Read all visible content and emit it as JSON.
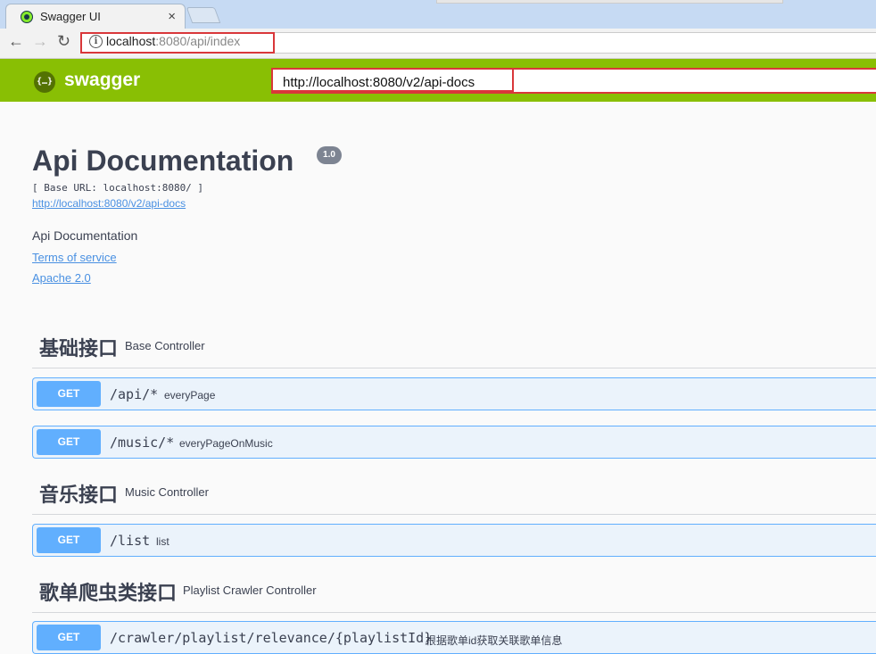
{
  "browser": {
    "tab_title": "Swagger UI",
    "tab_close": "×",
    "url_host": "localhost",
    "url_rest": ":8080/api/index",
    "back": "←",
    "forward": "→",
    "reload": "↻",
    "info": "i"
  },
  "swagger": {
    "logo_glyph": "{…}",
    "logo_text": "swagger",
    "spec_url": "http://localhost:8080/v2/api-docs",
    "highlight_color": "#d9373a",
    "brand_color": "#89bf04"
  },
  "info": {
    "title": "Api Documentation",
    "version": "1.0",
    "base_url": "[ Base URL: localhost:8080/ ]",
    "docs_link": "http://localhost:8080/v2/api-docs",
    "description": "Api Documentation",
    "terms": "Terms of service",
    "license": "Apache 2.0"
  },
  "sections": [
    {
      "name": "基础接口",
      "controller": "Base Controller",
      "operations": [
        {
          "method": "GET",
          "path": "/api/*",
          "summary": "everyPage"
        },
        {
          "method": "GET",
          "path": "/music/*",
          "summary": "everyPageOnMusic"
        }
      ]
    },
    {
      "name": "音乐接口",
      "controller": "Music Controller",
      "operations": [
        {
          "method": "GET",
          "path": "/list",
          "summary": "list"
        }
      ]
    },
    {
      "name": "歌单爬虫类接口",
      "controller": "Playlist Crawler Controller",
      "operations": [
        {
          "method": "GET",
          "path": "/crawler/playlist/relevance/{playlistId}",
          "summary": "根据歌单id获取关联歌单信息"
        }
      ]
    }
  ]
}
